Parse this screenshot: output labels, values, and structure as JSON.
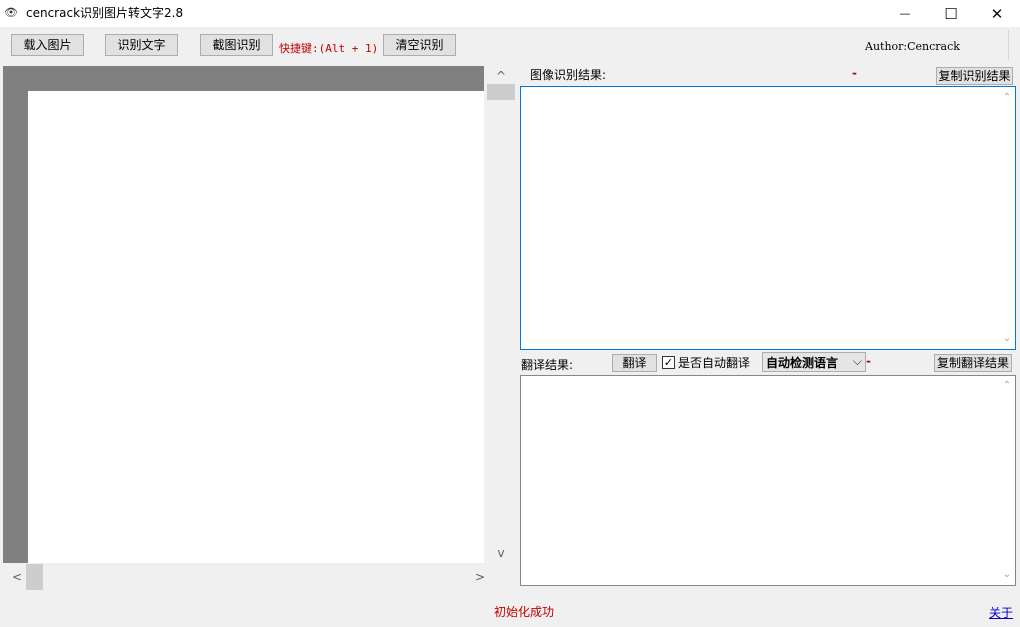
{
  "window": {
    "icon_glyph": "👁",
    "title": "cencrack识别图片转文字2.8",
    "minimize_glyph": "—",
    "maximize_glyph": "☐",
    "close_glyph": "✕"
  },
  "toolbar": {
    "load_image": "载入图片",
    "recognize_text": "识别文字",
    "screenshot_recognize": "截图识别",
    "hotkey": "快捷键:(Alt + 1)",
    "clear_recognition": "清空识别",
    "author": "Author:Cencrack"
  },
  "image_panel": {
    "scroll_up": "^",
    "scroll_down": "v",
    "scroll_left": "<",
    "scroll_right": ">"
  },
  "ocr": {
    "label": "图像识别结果:",
    "dash": "-",
    "copy_button": "复制识别结果",
    "result_text": ""
  },
  "translate": {
    "label": "翻译结果:",
    "translate_button": "翻译",
    "auto_translate_label": "是否自动翻译",
    "auto_translate_checked": true,
    "check_glyph": "✓",
    "language_selected": "自动检测语言",
    "dropdown_glyph": "⌵",
    "dash": "-",
    "copy_button": "复制翻译结果",
    "result_text": ""
  },
  "status": {
    "message": "初始化成功",
    "about_link": "关于"
  }
}
